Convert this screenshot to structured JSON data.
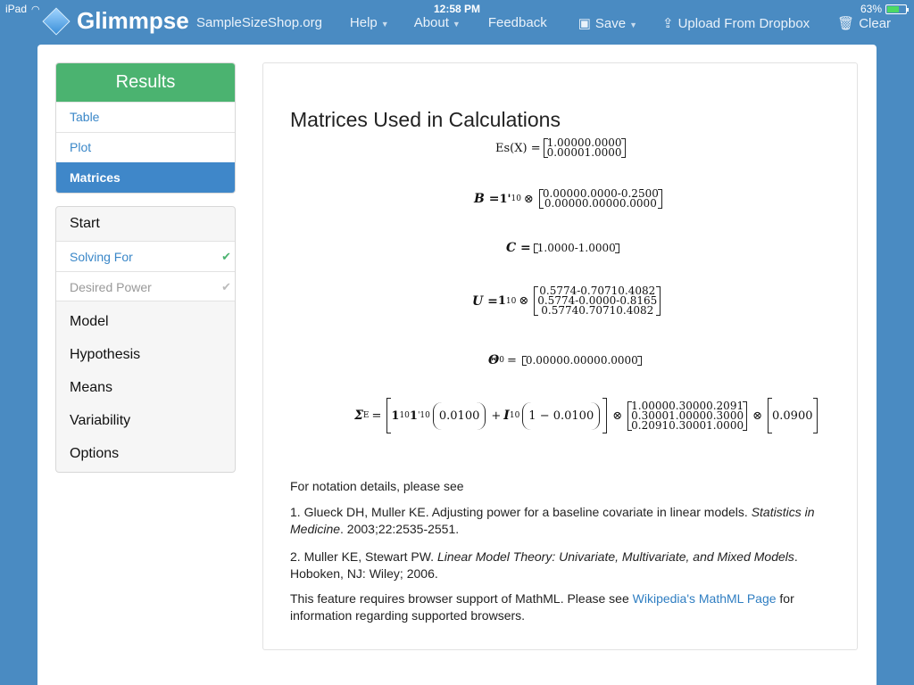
{
  "status_bar": {
    "device": "iPad",
    "time": "12:58 PM",
    "battery_percent": "63%",
    "battery_level": 0.63
  },
  "nav": {
    "brand": "Glimmpse",
    "items": {
      "site": "SampleSizeShop.org",
      "help": "Help",
      "about": "About",
      "feedback": "Feedback",
      "save": "Save",
      "upload": "Upload From Dropbox",
      "clear": "Clear"
    },
    "icons": {
      "save": "floppy-disk-icon",
      "upload": "upload-icon",
      "clear": "trash-icon"
    }
  },
  "results_panel": {
    "header": "Results",
    "items": [
      "Table",
      "Plot",
      "Matrices"
    ],
    "active": "Matrices"
  },
  "steps_panel": {
    "start": "Start",
    "solving_for": "Solving For",
    "desired_power": "Desired Power",
    "items": [
      "Model",
      "Hypothesis",
      "Means",
      "Variability",
      "Options"
    ]
  },
  "content": {
    "title": "Matrices Used in Calculations",
    "equations": {
      "es_x": {
        "lhs": "Es(X) =",
        "rows": [
          "1.00000.0000",
          "0.00001.0000"
        ]
      },
      "b": {
        "lhs": "B =",
        "factor": "1'",
        "factor_sub": "10",
        "rows": [
          "0.00000.0000-0.2500",
          "0.00000.00000.0000"
        ]
      },
      "c": {
        "lhs": "C =",
        "rows": [
          "1.0000-1.0000"
        ]
      },
      "u": {
        "lhs": "U =",
        "factor": "1",
        "factor_sub": "10",
        "rows": [
          "0.5774-0.70710.4082",
          "0.5774-0.0000-0.8165",
          "0.57740.70710.4082"
        ]
      },
      "theta": {
        "lhs": "Θ",
        "lhs_sub": "0",
        "rows": [
          "0.00000.00000.0000"
        ]
      },
      "sigma": {
        "lhs": "Σ",
        "lhs_sub": "E",
        "term1": "0.0100",
        "term2": "1 − 0.0100",
        "rows": [
          "1.00000.30000.2091",
          "0.30001.00000.3000",
          "0.20910.30001.0000"
        ],
        "scalar": "0.0900"
      }
    },
    "notes": {
      "intro": "For notation details, please see",
      "ref1_prefix": "1. Glueck DH, Muller KE. Adjusting power for a baseline covariate in linear models. ",
      "ref1_journal": "Statistics in Medicine",
      "ref1_suffix": ". 2003;22:2535-2551.",
      "ref2_prefix": "2. Muller KE, Stewart PW. ",
      "ref2_title": "Linear Model Theory: Univariate, Multivariate, and Mixed Models",
      "ref2_suffix": ". Hoboken, NJ: Wiley; 2006.",
      "mathml_prefix": "This feature requires browser support of MathML. Please see ",
      "mathml_link": "Wikipedia's MathML Page",
      "mathml_suffix": " for information regarding supported browsers."
    }
  }
}
